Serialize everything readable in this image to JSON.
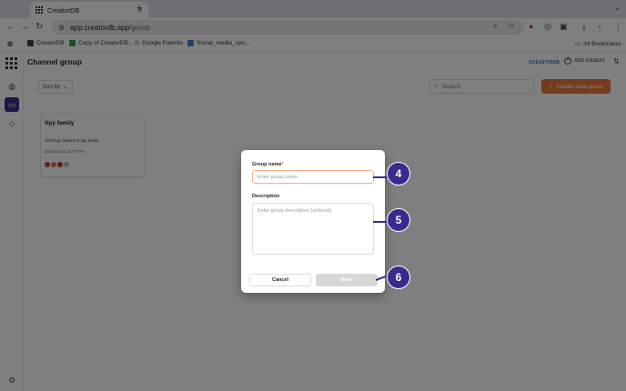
{
  "browser": {
    "tab_title": "CreatorDB",
    "tab_close": "✕",
    "new_tab": "+",
    "url_host": "app.creatordb.app",
    "url_path": "/group",
    "bookmarks": [
      "CreatorDB",
      "Copy of CreatorDB...",
      "Google Patents",
      "Social_media_spo..."
    ],
    "all_bookmarks": "All Bookmarks"
  },
  "app": {
    "page_title": "Channel group",
    "brand": "CREATORDB",
    "add_creators": "Add creators",
    "sort_by": "Sort by",
    "search_placeholder": "Search",
    "create_button": "Create new group"
  },
  "card": {
    "name": "Spy family",
    "description": "All things related to spy family.",
    "date": "2024-11-07 16:27 PM"
  },
  "modal": {
    "group_name_label": "Group name",
    "required_mark": "*",
    "group_name_placeholder": "Enter group name",
    "description_label": "Description",
    "description_placeholder": "Enter group description (optional)",
    "cancel_label": "Cancel",
    "save_label": "Save"
  },
  "callouts": [
    "4",
    "5",
    "6"
  ],
  "colors": {
    "accent_orange": "#e8763a",
    "callout_purple": "#3a2a8f",
    "rail_active": "#3c2c8c"
  }
}
